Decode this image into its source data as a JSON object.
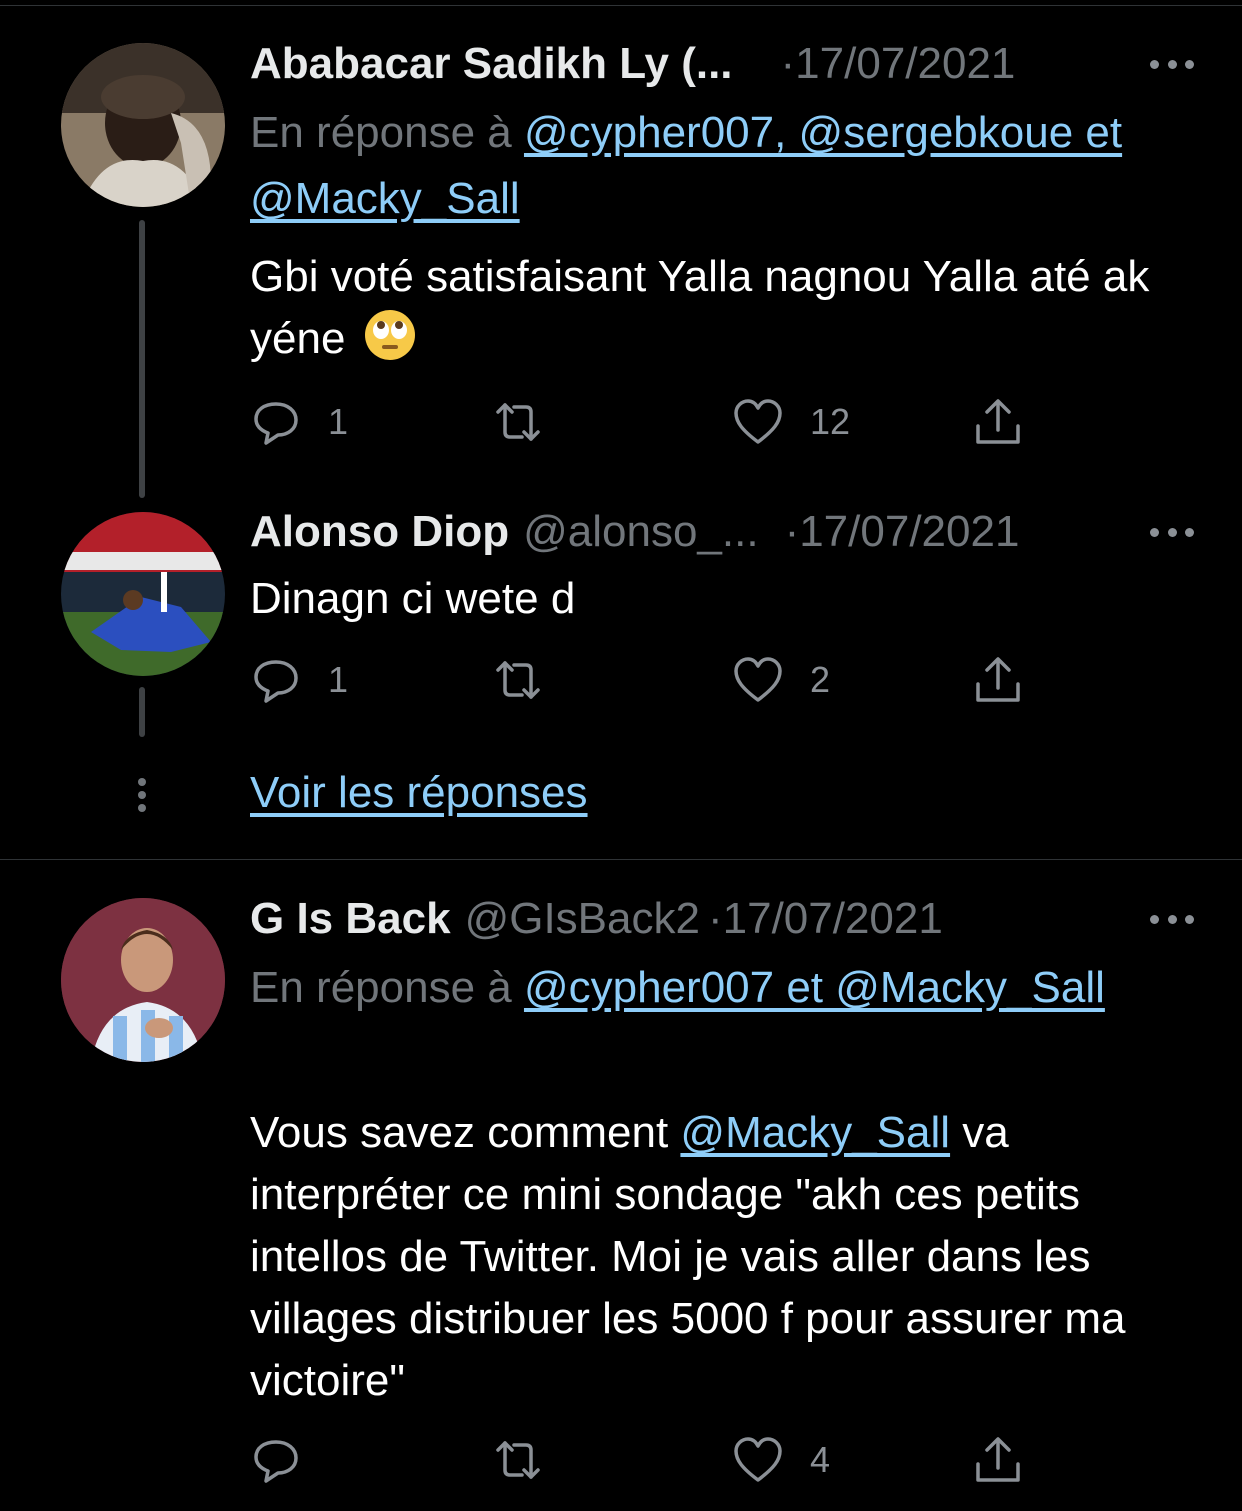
{
  "tweets": [
    {
      "name": "Ababacar Sadikh Ly (...",
      "handle": "",
      "date": "·17/07/2021",
      "reply_prefix": "En réponse à ",
      "reply_mentions": "@cypher007, @sergebkoue et @Macky_Sall",
      "text": "Gbi voté satisfaisant Yalla nagnou Yalla até ak yéne",
      "emoji": "face-with-rolling-eyes",
      "replies": "1",
      "retweets": "",
      "likes": "12"
    },
    {
      "name": "Alonso Diop",
      "handle": "@alonso_...",
      "date": "·17/07/2021",
      "text": "Dinagn ci wete d",
      "replies": "1",
      "retweets": "",
      "likes": "2"
    },
    {
      "name": "G Is Back",
      "handle": "@GIsBack2",
      "date": "·17/07/2021",
      "reply_prefix": "En réponse à ",
      "reply_mentions": "@cypher007 et @Macky_Sall",
      "text_before": "Vous savez comment ",
      "text_mention": "@Macky_Sall",
      "text_after": " va interpréter ce mini sondage \"akh ces petits intellos de Twitter. Moi je vais aller dans les villages distribuer les 5000 f pour assurer ma victoire\"",
      "replies": "",
      "retweets": "",
      "likes": "4"
    }
  ],
  "show_replies_label": "Voir les réponses",
  "colors": {
    "background": "#000000",
    "link": "#8ecdf8",
    "muted": "#71767b",
    "text": "#ffffff"
  }
}
